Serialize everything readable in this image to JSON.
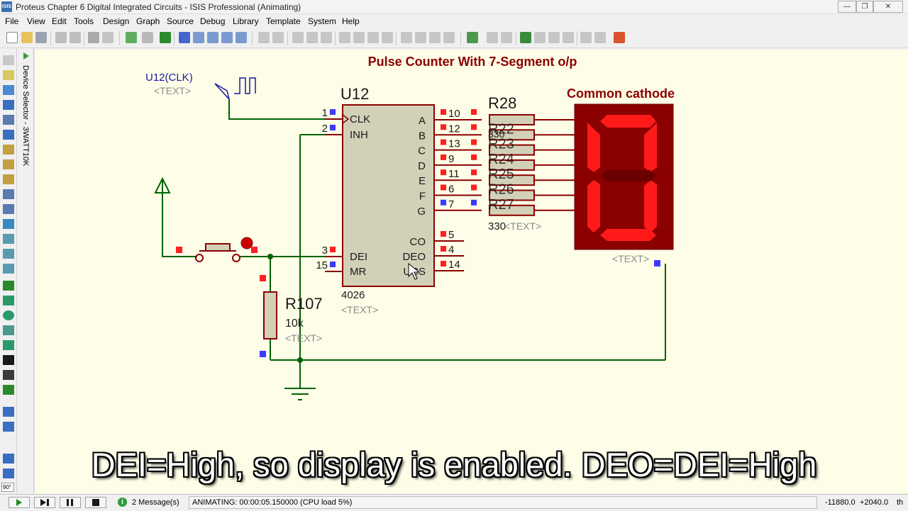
{
  "window": {
    "icon_text": "ISIS",
    "title": "Proteus Chapter 6 Digital Integrated Circuits - ISIS Professional (Animating)",
    "minimize": "—",
    "maximize": "❐",
    "close": "✕"
  },
  "menu": [
    "File",
    "View",
    "Edit",
    "Tools",
    "Design",
    "Graph",
    "Source",
    "Debug",
    "Library",
    "Template",
    "System",
    "Help"
  ],
  "device_selector": {
    "label": "Device Selector - 3WATT10K"
  },
  "rotation": "90°",
  "colors": {
    "wire": "#006400",
    "body": "#d3d0b8",
    "outline": "#8b0000",
    "pin_hi": "#ff2020",
    "pin_lo": "#3a3aff",
    "segment_on": "#ff1a1a",
    "segment_off": "#6a0000",
    "title": "#8b0000"
  },
  "schematic": {
    "title": "Pulse Counter With 7-Segment o/p",
    "generator": {
      "name": "U12(CLK)",
      "text": "<TEXT>"
    },
    "ic": {
      "ref": "U12",
      "part": "4026",
      "text": "<TEXT>",
      "left_pins": [
        {
          "num": "1",
          "name": "CLK",
          "state": "low"
        },
        {
          "num": "2",
          "name": "INH",
          "state": "low"
        },
        {
          "num": "3",
          "name": "DEI",
          "state": "high"
        },
        {
          "num": "15",
          "name": "MR",
          "state": "low"
        }
      ],
      "right_pins": [
        {
          "num": "10",
          "name": "A",
          "state": "high"
        },
        {
          "num": "12",
          "name": "B",
          "state": "high"
        },
        {
          "num": "13",
          "name": "C",
          "state": "high"
        },
        {
          "num": "9",
          "name": "D",
          "state": "high"
        },
        {
          "num": "11",
          "name": "E",
          "state": "high"
        },
        {
          "num": "6",
          "name": "F",
          "state": "high"
        },
        {
          "num": "7",
          "name": "G",
          "state": "low"
        }
      ],
      "right_pins_lower": [
        {
          "num": "5",
          "name": "CO",
          "state": "high"
        },
        {
          "num": "4",
          "name": "DEO",
          "state": "high"
        },
        {
          "num": "14",
          "name": "UCS",
          "state": "high"
        }
      ]
    },
    "resistor_bank": {
      "labels": [
        "R28",
        "R22",
        "R23",
        "R24",
        "R25",
        "R26",
        "R27"
      ],
      "value": "330",
      "value_overlap": "330",
      "text": "<TEXT>"
    },
    "display": {
      "title": "Common cathode",
      "text": "<TEXT>",
      "segments": {
        "a": true,
        "b": true,
        "c": true,
        "d": true,
        "e": true,
        "f": true,
        "g": false
      }
    },
    "pulldown": {
      "ref": "R107",
      "value": "10k",
      "text": "<TEXT>"
    }
  },
  "caption": "DEI=High, so display is enabled. DEO=DEI=High",
  "statusbar": {
    "messages": "2 Message(s)",
    "animating": "ANIMATING: 00:00:05.150000 (CPU load 5%)",
    "x": "-11880.0",
    "y": "+2040.0",
    "unit": "th"
  }
}
